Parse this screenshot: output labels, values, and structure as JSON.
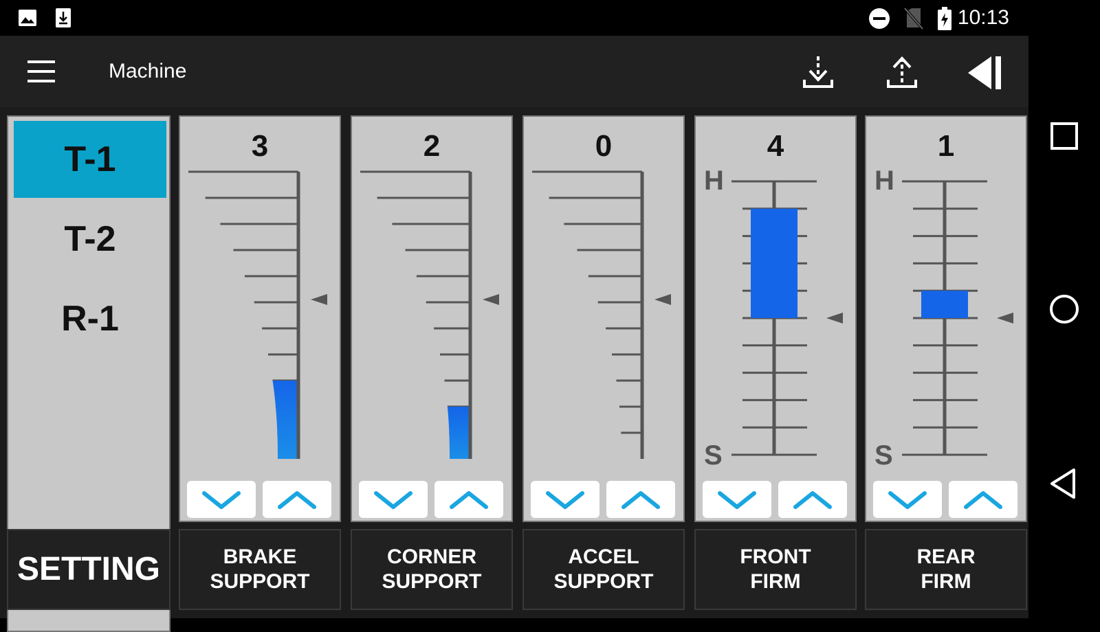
{
  "status": {
    "time": "10:13",
    "left_icons": [
      "image-icon",
      "download-icon"
    ],
    "right_icons": [
      "do-not-disturb-icon",
      "no-sim-icon",
      "battery-charging-icon"
    ]
  },
  "appbar": {
    "title": "Machine",
    "actions": [
      "download-icon",
      "upload-icon",
      "collapse-panel-icon"
    ]
  },
  "tunes": {
    "items": [
      "T-1",
      "T-2",
      "R-1"
    ],
    "selected": "T-1"
  },
  "setting_label": "SETTING",
  "controls": [
    {
      "id": "brake-support",
      "label": "BRAKE\nSUPPORT",
      "value": "3",
      "type": "support",
      "level": 3,
      "max": 8
    },
    {
      "id": "corner-support",
      "label": "CORNER\nSUPPORT",
      "value": "2",
      "type": "support",
      "level": 2,
      "max": 8
    },
    {
      "id": "accel-support",
      "label": "ACCEL\nSUPPORT",
      "value": "0",
      "type": "support",
      "level": 0,
      "max": 8
    },
    {
      "id": "front-firm",
      "label": "FRONT\nFIRM",
      "value": "4",
      "type": "firm",
      "level": 4,
      "max": 10,
      "top_label": "H",
      "bottom_label": "S"
    },
    {
      "id": "rear-firm",
      "label": "REAR\nFIRM",
      "value": "1",
      "type": "firm",
      "level": 1,
      "max": 10,
      "top_label": "H",
      "bottom_label": "S"
    }
  ],
  "colors": {
    "selected": "#0aa2c9",
    "fill": "#1565e8",
    "fill_light": "#1a8ee8",
    "chevron": "#1aa6e0"
  },
  "navbar": {
    "icons": [
      "recents-icon",
      "home-icon",
      "back-icon"
    ]
  }
}
